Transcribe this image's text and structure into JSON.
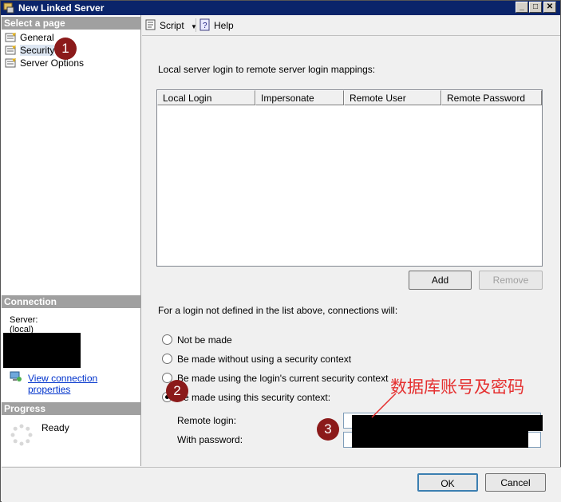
{
  "window": {
    "title": "New Linked Server",
    "controls": {
      "minimize": "_",
      "maximize": "□",
      "close": "✕"
    }
  },
  "left_panel": {
    "select_page_header": "Select a page",
    "pages": [
      {
        "label": "General",
        "icon": "page-icon"
      },
      {
        "label": "Security",
        "icon": "page-icon"
      },
      {
        "label": "Server Options",
        "icon": "page-icon"
      }
    ],
    "connection_header": "Connection",
    "server_label": "Server:",
    "server_value": "(local)",
    "view_connection_link": "View connection properties",
    "progress_header": "Progress",
    "progress_status": "Ready"
  },
  "toolbar": {
    "script_label": "Script",
    "help_label": "Help"
  },
  "security": {
    "mappings_label": "Local server login to remote server login mappings:",
    "columns": [
      "Local Login",
      "Impersonate",
      "Remote User",
      "Remote Password"
    ],
    "add_button": "Add",
    "remove_button": "Remove",
    "undefined_login_label": "For a login not defined in the list above, connections will:",
    "options": [
      {
        "label": "Not be made",
        "checked": false
      },
      {
        "label": "Be made without using a security context",
        "checked": false
      },
      {
        "label": "Be made using the login's current security context",
        "checked": false
      },
      {
        "label": "Be made using this security context:",
        "checked": true
      }
    ],
    "remote_login_label": "Remote login:",
    "with_password_label": "With password:"
  },
  "footer": {
    "ok_button": "OK",
    "cancel_button": "Cancel"
  },
  "annotations": {
    "badge_1": "1",
    "badge_2": "2",
    "badge_3": "3",
    "chinese_note": "数据库账号及密码",
    "note_color": "#e53030",
    "badge_color": "#8b1a1a"
  }
}
